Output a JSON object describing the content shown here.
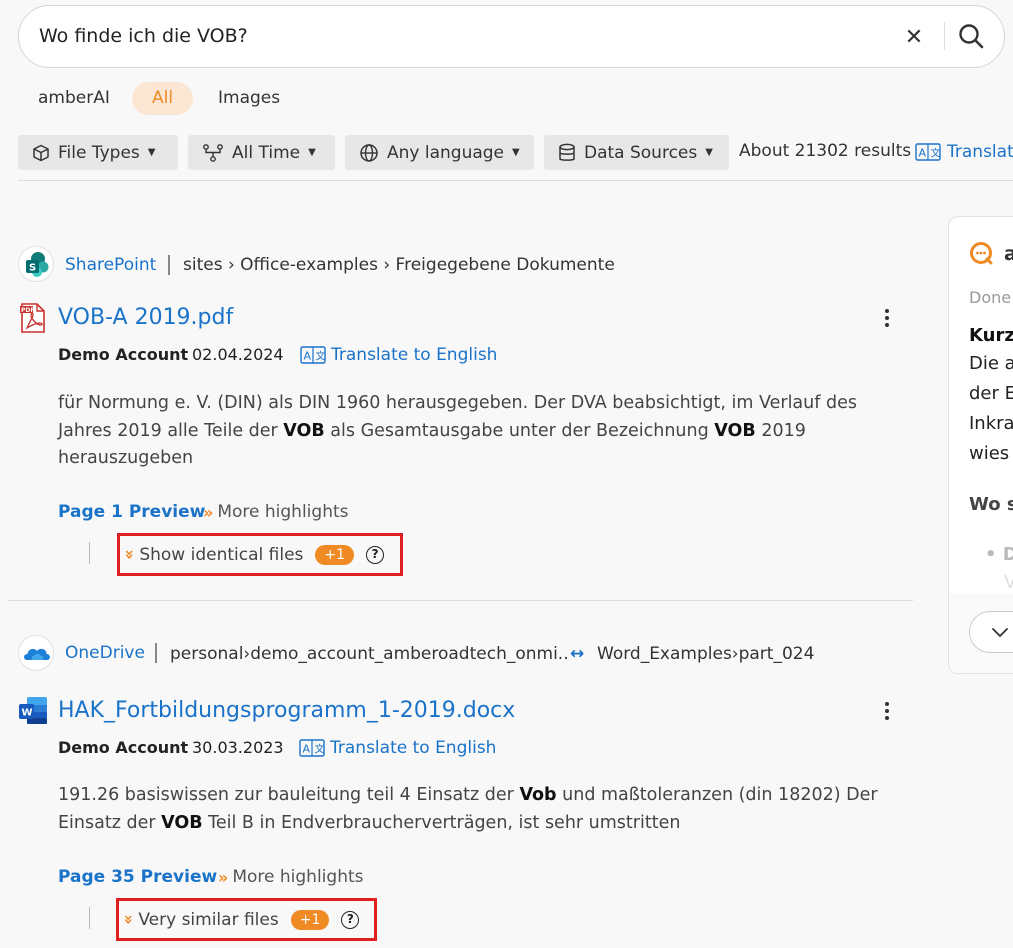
{
  "search": {
    "query": "Wo finde ich die VOB?"
  },
  "modes": [
    {
      "label": "amberAI",
      "active": false
    },
    {
      "label": "All",
      "active": true
    },
    {
      "label": "Images",
      "active": false
    }
  ],
  "filters": {
    "file_types": "File Types",
    "time": "All Time",
    "language": "Any language",
    "sources": "Data Sources"
  },
  "results_count": "About 21302 results",
  "translate_top": "Translate",
  "results": [
    {
      "source": "SharePoint",
      "path": "sites › Office-examples › Freigegebene Dokumente",
      "title": "VOB-A 2019.pdf",
      "owner": "Demo Account",
      "date": "02.04.2024",
      "translate": "Translate to English",
      "snippet": {
        "p1": "für Normung e. V. (DIN) als DIN 1960 herausgegeben. Der DVA beabsichtigt, im Verlauf des Jahres 2019 alle Teile der ",
        "h1": "VOB",
        "p2": " als Gesamtausgabe unter der Bezeichnung ",
        "h2": "VOB",
        "p3": " 2019 herauszugeben"
      },
      "preview": "Page 1 Preview",
      "more": "More highlights",
      "dup_label": "Show identical files",
      "dup_count": "+1",
      "help": "?"
    },
    {
      "source": "OneDrive",
      "path": "personal›demo_account_amberoadtech_onmi..",
      "path_link": "↔",
      "path_tail": "Word_Examples›part_024",
      "title": "HAK_Fortbildungsprogramm_1-2019.docx",
      "owner": "Demo Account",
      "date": "30.03.2023",
      "translate": "Translate to English",
      "snippet": {
        "p1": "191.26 basiswissen zur bauleitung teil 4 Einsatz der ",
        "h1": "Vob",
        "p2": " und maßtoleranzen (din 18202) Der Einsatz der ",
        "h2": "VOB",
        "p3": " Teil B in Endverbraucherverträgen, ist sehr umstritten"
      },
      "preview": "Page 35 Preview",
      "more": "More highlights",
      "dup_label": "Very similar files",
      "dup_count": "+1",
      "help": "?"
    }
  ],
  "ai_panel": {
    "name": "a",
    "status": "Done",
    "heading": "Kurz",
    "lines": [
      "Die a",
      "der E",
      "Inkra",
      "wies"
    ],
    "subheading": "Wo s",
    "bullet": "• D",
    "faded": "V"
  },
  "colors": {
    "accent": "#f08a24",
    "link": "#1a73c9",
    "highlight_box": "#e02020"
  }
}
